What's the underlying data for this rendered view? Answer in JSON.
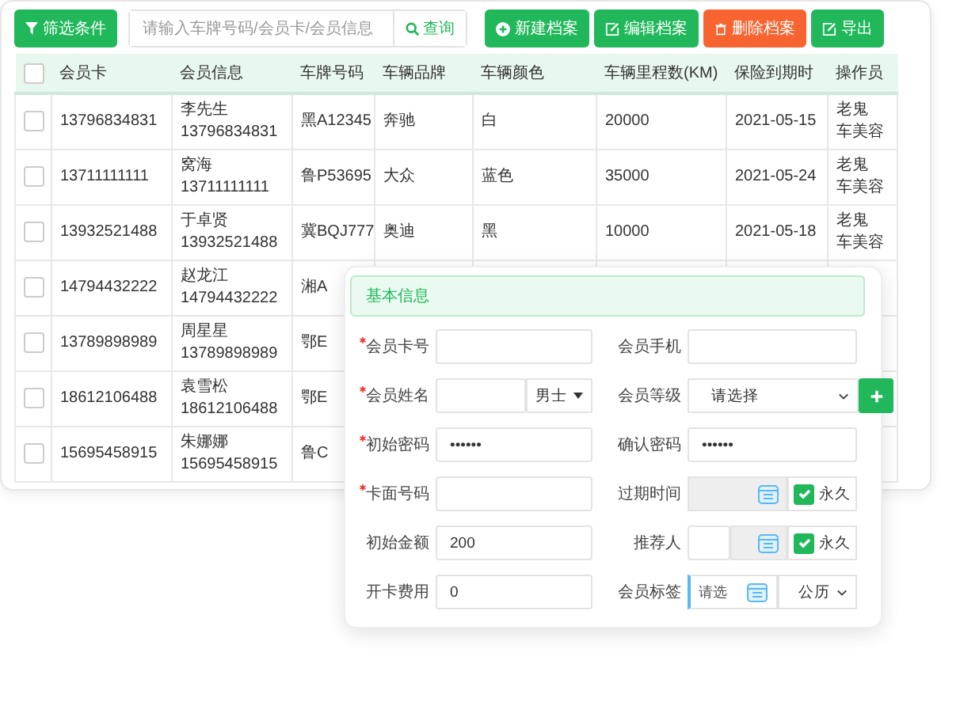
{
  "toolbar": {
    "filter_button": "筛选条件",
    "search": {
      "placeholder": "请输入车牌号码/会员卡/会员信息",
      "button": "查询"
    },
    "actions": [
      {
        "kind": "add",
        "label": "新建档案"
      },
      {
        "kind": "edit",
        "label": "编辑档案"
      },
      {
        "kind": "delete",
        "label": "删除档案"
      },
      {
        "kind": "export",
        "label": "导出"
      }
    ]
  },
  "table": {
    "header_checked": false,
    "columns": [
      "会员卡",
      "会员信息",
      "车牌号码",
      "车辆品牌",
      "车辆颜色",
      "车辆里程数(KM)",
      "保险到期时",
      "操作员"
    ],
    "rows": [
      {
        "checked": false,
        "cells": [
          "13796834831",
          [
            "李先生",
            "13796834831"
          ],
          "黑A12345",
          "奔驰",
          "白",
          "20000",
          "2021-05-15",
          [
            "老鬼",
            "车美容"
          ]
        ]
      },
      {
        "checked": false,
        "cells": [
          "13711111111",
          [
            "窝海",
            "13711111111"
          ],
          "鲁P53695",
          "大众",
          "蓝色",
          "35000",
          "2021-05-24",
          [
            "老鬼",
            "车美容"
          ]
        ]
      },
      {
        "checked": false,
        "cells": [
          "13932521488",
          [
            "于卓贤",
            "13932521488"
          ],
          "冀BQJ777",
          "奥迪",
          "黑",
          "10000",
          "2021-05-18",
          [
            "老鬼",
            "车美容"
          ]
        ]
      },
      {
        "checked": false,
        "cells": [
          "14794432222",
          [
            "赵龙江",
            "14794432222"
          ],
          "湘A"
        ]
      },
      {
        "checked": false,
        "cells": [
          "13789898989",
          [
            "周星星",
            "13789898989"
          ],
          "鄂E"
        ]
      },
      {
        "checked": false,
        "cells": [
          "18612106488",
          [
            "袁雪松",
            "18612106488"
          ],
          "鄂E"
        ]
      },
      {
        "checked": false,
        "cells": [
          "15695458915",
          [
            "朱娜娜",
            "15695458915"
          ],
          "鲁C"
        ]
      }
    ]
  },
  "form": {
    "title": "基本信息",
    "rows": [
      [
        {
          "label": "会员卡号",
          "required": true,
          "kind": "text"
        },
        {
          "label": "会员手机",
          "required": false,
          "kind": "text"
        }
      ],
      [
        {
          "label": "会员姓名",
          "required": true,
          "kind": "gender",
          "option": "男士"
        },
        {
          "label": "会员等级",
          "required": false,
          "kind": "select-add",
          "value": "请选择"
        }
      ],
      [
        {
          "label": "初始密码",
          "required": true,
          "kind": "text",
          "value": "••••••"
        },
        {
          "label": "确认密码",
          "required": false,
          "kind": "text",
          "value": "••••••"
        }
      ],
      [
        {
          "label": "卡面号码",
          "required": true,
          "kind": "text"
        },
        {
          "label": "过期时间",
          "required": false,
          "kind": "date-check",
          "check_label": "永久",
          "checked": true
        }
      ],
      [
        {
          "label": "初始金额",
          "required": false,
          "kind": "text",
          "value": "200"
        },
        {
          "label": "推荐人",
          "required": false,
          "kind": "split-date-check",
          "check_label": "永久",
          "checked": true
        }
      ],
      [
        {
          "label": "开卡费用",
          "required": false,
          "kind": "text",
          "value": "0"
        },
        {
          "label": "会员标签",
          "required": false,
          "kind": "tag-date",
          "placeholder": "请选",
          "calendar": "公历"
        }
      ]
    ]
  }
}
